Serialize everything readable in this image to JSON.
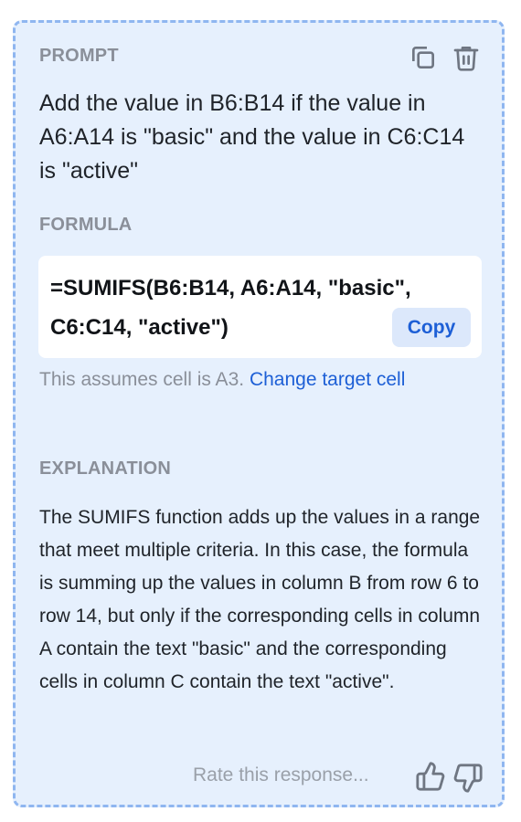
{
  "prompt": {
    "label": "PROMPT",
    "text": "Add the value in B6:B14 if the value in A6:A14 is \"basic\" and the value in C6:C14 is \"active\""
  },
  "formula": {
    "label": "FORMULA",
    "text": "=SUMIFS(B6:B14, A6:A14, \"basic\", C6:C14, \"active\")",
    "copy_label": "Copy",
    "note_prefix": "This assumes cell is A3.",
    "note_link": "Change target cell"
  },
  "explanation": {
    "label": "EXPLANATION",
    "text": "The SUMIFS function adds up the values in a range that meet multiple criteria. In this case, the formula is summing up the values in column B from row 6 to row 14, but only if the corresponding cells in column A contain the text \"basic\" and the corresponding cells in column C contain the text \"active\"."
  },
  "feedback": {
    "rate_label": "Rate this response..."
  },
  "colors": {
    "card_background": "#e6f0fd",
    "card_border": "#8fb6f0",
    "accent": "#1d5fd6",
    "muted_label": "#8a8f99"
  },
  "icons": {
    "prompt_actions": [
      "copy-icon",
      "trash-icon"
    ],
    "feedback": [
      "thumbs-up-icon",
      "thumbs-down-icon"
    ]
  }
}
